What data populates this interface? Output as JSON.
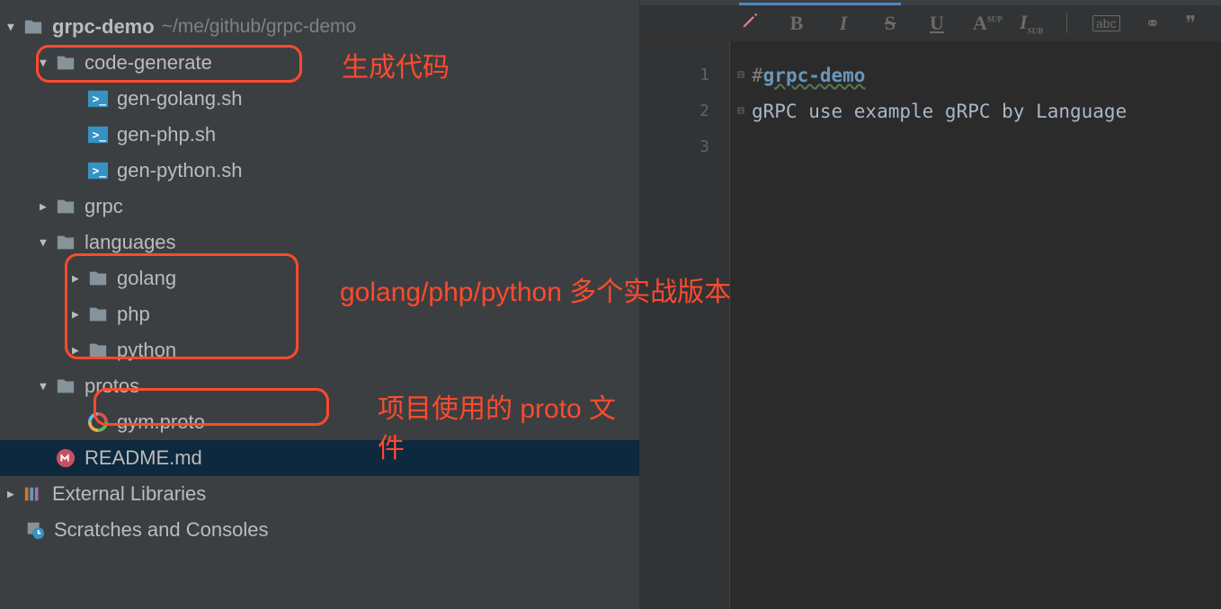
{
  "sidebar": {
    "root": {
      "label": "grpc-demo",
      "path": "~/me/github/grpc-demo"
    },
    "tree": [
      {
        "indent": 1,
        "chev": "down",
        "icon": "folder",
        "label": "code-generate"
      },
      {
        "indent": 2,
        "chev": "",
        "icon": "sh",
        "label": "gen-golang.sh"
      },
      {
        "indent": 2,
        "chev": "",
        "icon": "sh",
        "label": "gen-php.sh"
      },
      {
        "indent": 2,
        "chev": "",
        "icon": "sh",
        "label": "gen-python.sh"
      },
      {
        "indent": 1,
        "chev": "right",
        "icon": "folder",
        "label": "grpc"
      },
      {
        "indent": 1,
        "chev": "down",
        "icon": "folder",
        "label": "languages"
      },
      {
        "indent": 2,
        "chev": "right",
        "icon": "folder",
        "label": "golang"
      },
      {
        "indent": 2,
        "chev": "right",
        "icon": "folder",
        "label": "php"
      },
      {
        "indent": 2,
        "chev": "right",
        "icon": "folder",
        "label": "python"
      },
      {
        "indent": 1,
        "chev": "down",
        "icon": "folder",
        "label": "protos"
      },
      {
        "indent": 2,
        "chev": "",
        "icon": "proto",
        "label": "gym.proto"
      },
      {
        "indent": 1,
        "chev": "",
        "icon": "md",
        "label": "README.md",
        "selected": true
      }
    ],
    "external": "External Libraries",
    "scratches": "Scratches and Consoles"
  },
  "toolbar": {
    "bold": "B",
    "italic": "I",
    "strike": "S",
    "underline": "U",
    "sup": "A",
    "sub": "I",
    "abc": "abc"
  },
  "editor": {
    "lines": [
      "1",
      "2",
      "3"
    ],
    "line1_hash": "# ",
    "line1_text": "grpc-demo",
    "line3": "gRPC use example gRPC by Language"
  },
  "annotations": {
    "a1": "生成代码",
    "a2": "golang/php/python 多个实战版本",
    "a3": "项目使用的 proto 文件"
  }
}
